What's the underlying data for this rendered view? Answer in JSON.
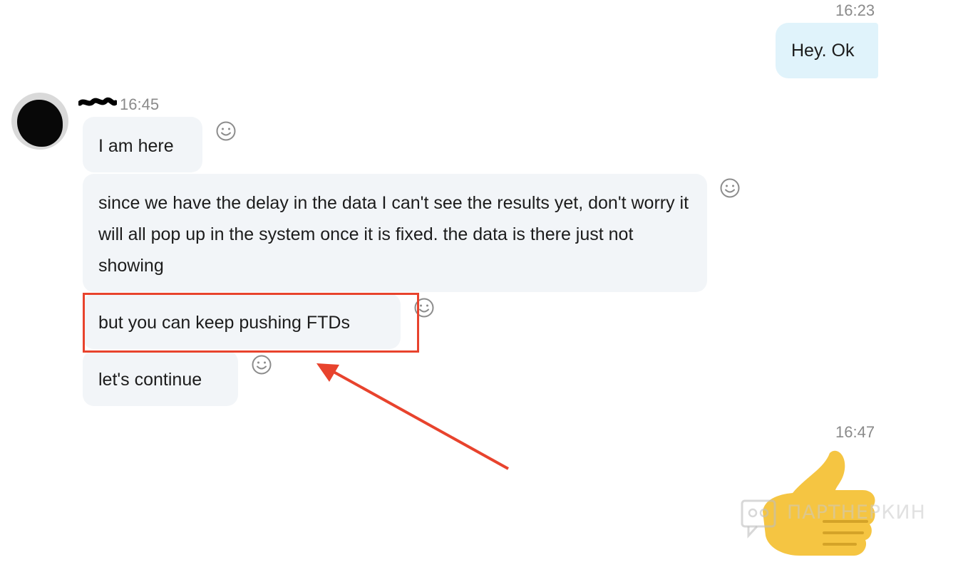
{
  "conversation": {
    "outgoing_1": {
      "time": "16:23",
      "text": "Hey. Ok"
    },
    "incoming_group": {
      "time": "16:45",
      "messages": [
        "I am here",
        "since we have the delay in the data I can't see the results yet, don't worry it will all pop up in the system once it is fixed. the data is there just not showing",
        "but you can keep pushing FTDs",
        "let's continue"
      ]
    },
    "outgoing_2": {
      "time": "16:47",
      "emoji": "thumbs-up"
    }
  },
  "annotation": {
    "color": "#e8432d"
  },
  "watermark": {
    "text": "ПАРТНЕРКИН"
  },
  "colors": {
    "incoming_bubble": "#f2f5f8",
    "outgoing_bubble": "#e0f3fb",
    "timestamp": "#8a8a8a",
    "thumb": "#f5c542"
  }
}
